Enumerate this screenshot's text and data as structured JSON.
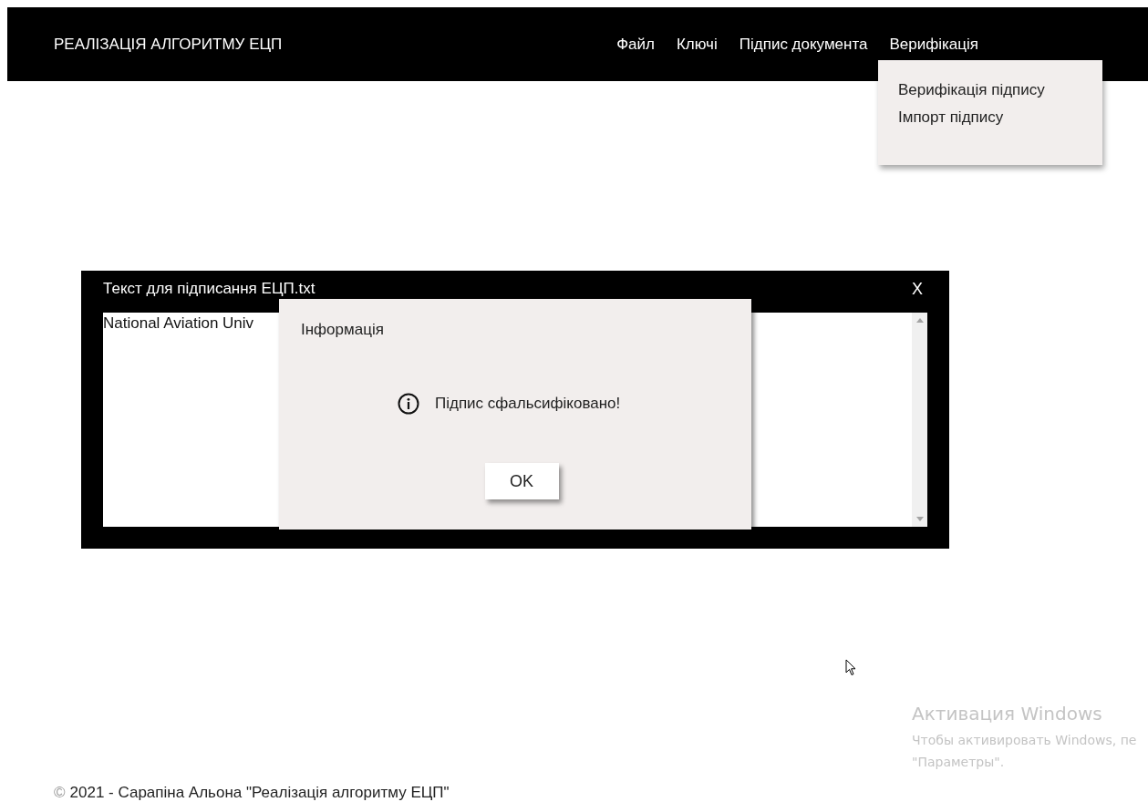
{
  "header": {
    "title": "РЕАЛІЗАЦІЯ АЛГОРИТМУ ЕЦП"
  },
  "nav": [
    "Файл",
    "Ключі",
    "Підпис документа",
    "Верифікація"
  ],
  "dropdown": [
    "Верифікація підпису",
    "Імпорт підпису"
  ],
  "file_window": {
    "title": "Текст для підписання ЕЦП.txt",
    "close": "X",
    "content": "National Aviation Univ"
  },
  "dialog": {
    "title": "Інформація",
    "message": "Підпис сфальсифіковано!",
    "button": "OK"
  },
  "os_notice": {
    "title": "Активация Windows",
    "lines": [
      "Чтобы активировать Windows, пе",
      "\"Параметры\"."
    ]
  },
  "footer": {
    "copyright": "©",
    "text": "2021 - Сарапіна Альона \"Реалізація алгоритму ЕЦП\""
  }
}
